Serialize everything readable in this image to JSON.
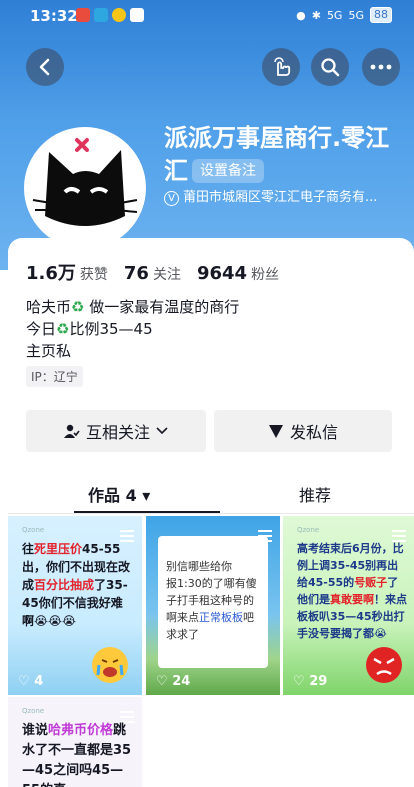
{
  "status_bar": {
    "time": "13:32",
    "battery": "88",
    "net1": "5G",
    "net2": "5G"
  },
  "profile": {
    "name": "派派万事屋商行.零江汇",
    "remark_label": "设置备注",
    "verify_text": "莆田市城厢区零江汇电子商务有...",
    "stats": [
      {
        "num": "1.6万",
        "label": "获赞"
      },
      {
        "num": "76",
        "label": "关注"
      },
      {
        "num": "9644",
        "label": "粉丝"
      }
    ],
    "bio_line1_prefix": "哈夫币",
    "bio_line1_suffix": " 做一家最有温度的商行",
    "bio_line2_prefix": "今日",
    "bio_line2_suffix": "比例35—45",
    "bio_line3": "主页私",
    "ip": "IP：辽宁"
  },
  "actions": {
    "follow": "互相关注",
    "message": "发私信"
  },
  "tabs": {
    "works": "作品 4",
    "recommend": "推荐"
  },
  "grid": [
    {
      "likes": "4"
    },
    {
      "likes": "24"
    },
    {
      "likes": "29"
    },
    {
      "likes": ""
    }
  ],
  "tile1": {
    "pre": "往",
    "red1": "死里压价",
    "mid1": "45-55出，你们不出现在改成",
    "red2": "百分比抽成",
    "rest": "了35-45你们不信我好难啊😭😭😭"
  },
  "tile2": {
    "line1": "别信哪些给你",
    "line2": "报1:30的了哪有傻",
    "line3": "子打手租这种号的",
    "line4a": "啊来点",
    "line4b": "正常板板",
    "line4c": "吧",
    "line5": "求求了"
  },
  "tile3": {
    "pre": "高考结束后6月份，比例上调35-45别再出给45-55的",
    "red1": "号贩子",
    "mid": "了他们是",
    "red2": "真敢要啊",
    "rest": "！来点板板叭35—45秒出打手没号要揭了都😭"
  },
  "tile4": {
    "pre": "谁说",
    "purple": "哈弗币价格",
    "rest": "跳水了不一直都是35—45之间吗45—55的真"
  },
  "colors": {
    "header_top": "#2f7fd6",
    "accent_green": "#2fa84f",
    "highlight_red": "#e3232c"
  },
  "icons": [
    "back-arrow-icon",
    "pointer-hand-icon",
    "search-icon",
    "more-icon",
    "user-check-icon",
    "chevron-down-icon",
    "send-plane-icon",
    "heart-icon",
    "recycle-icon",
    "verified-icon"
  ]
}
